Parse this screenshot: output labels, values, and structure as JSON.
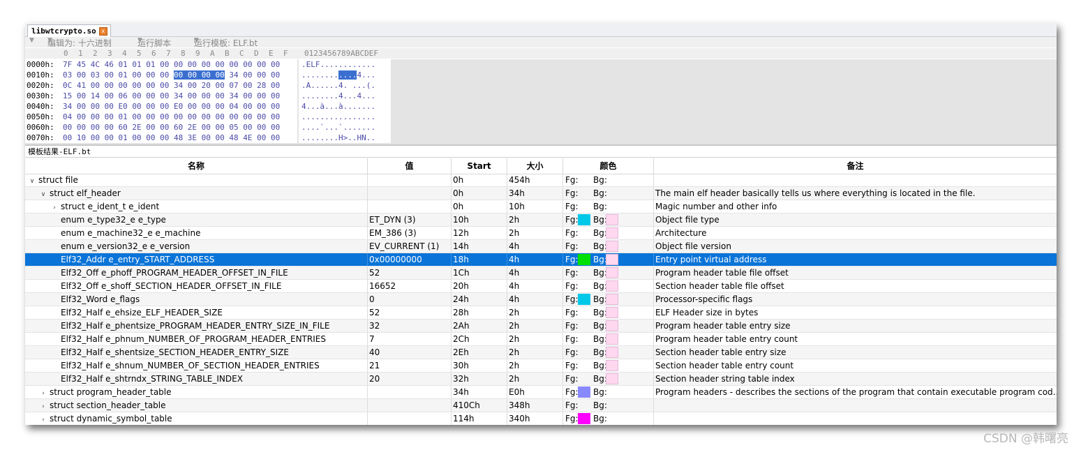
{
  "tab": {
    "label": "libwtcrypto.so",
    "close": "x"
  },
  "toolbar": {
    "edit_as": "编辑为: 十六进制",
    "run_script": "运行脚本",
    "run_template": "运行模板: ELF.bt"
  },
  "hex_header": {
    "columns": [
      "0",
      "1",
      "2",
      "3",
      "4",
      "5",
      "6",
      "7",
      "8",
      "9",
      "A",
      "B",
      "C",
      "D",
      "E",
      "F"
    ],
    "ascii_header": "0123456789ABCDEF"
  },
  "hex_rows": [
    {
      "addr": "0000h:",
      "bytes": "7F 45 4C 46 01 01 01 00 00 00 00 00 00 00 00 00",
      "ascii": ".ELF............"
    },
    {
      "addr": "0010h:",
      "bytes_pre": "03 00 03 00 01 00 00 00 ",
      "bytes_sel": "00 00 00 00",
      "bytes_post": " 34 00 00 00",
      "ascii_pre": "........",
      "ascii_sel": "....",
      "ascii_post": "4..."
    },
    {
      "addr": "0020h:",
      "bytes": "0C 41 00 00 00 00 00 00 34 00 20 00 07 00 28 00",
      "ascii": ".A......4. ...(."
    },
    {
      "addr": "0030h:",
      "bytes": "15 00 14 00 06 00 00 00 34 00 00 00 34 00 00 00",
      "ascii": "........4...4..."
    },
    {
      "addr": "0040h:",
      "bytes": "34 00 00 00 E0 00 00 00 E0 00 00 00 04 00 00 00",
      "ascii": "4...à...à......."
    },
    {
      "addr": "0050h:",
      "bytes": "04 00 00 00 01 00 00 00 00 00 00 00 00 00 00 00",
      "ascii": "................"
    },
    {
      "addr": "0060h:",
      "bytes": "00 00 00 00 60 2E 00 00 60 2E 00 00 05 00 00 00",
      "ascii": "....`...`......."
    },
    {
      "addr": "0070h:",
      "bytes": "00 10 00 00 01 00 00 00 48 3E 00 00 48 4E 00 00",
      "ascii": "........H>..HN.."
    }
  ],
  "results_title": "模板结果-ELF.bt",
  "columns": {
    "name": "名称",
    "value": "值",
    "start": "Start",
    "size": "大小",
    "color": "颜色",
    "comment": "备注"
  },
  "colors": {
    "cyan": "#00c8e8",
    "green": "#00e000",
    "pink": "#ffd8f0",
    "periwinkle": "#8888ff",
    "magenta": "#ff00ff",
    "selection": "#0a74d8"
  },
  "rows": [
    {
      "name": "struct file",
      "value": "",
      "start": "0h",
      "size": "454h",
      "fg": "Fg:",
      "bg": "Bg:",
      "comment": "",
      "expander": "∨",
      "fgcolor": "",
      "bgcolor": ""
    },
    {
      "name": "struct elf_header",
      "value": "",
      "start": "0h",
      "size": "34h",
      "fg": "Fg:",
      "bg": "Bg:",
      "comment": "The main elf header basically tells us where everything is located in the file.",
      "expander": "∨",
      "fgcolor": "",
      "bgcolor": ""
    },
    {
      "name": "struct e_ident_t e_ident",
      "value": "",
      "start": "0h",
      "size": "10h",
      "fg": "Fg:",
      "bg": "Bg:",
      "comment": "Magic number and other info",
      "expander": "›",
      "fgcolor": "",
      "bgcolor": ""
    },
    {
      "name": "enum e_type32_e e_type",
      "value": "ET_DYN (3)",
      "start": "10h",
      "size": "2h",
      "fg": "Fg:",
      "bg": "Bg:",
      "comment": "Object file type",
      "expander": "",
      "fgcolor": "#00c8e8",
      "bgcolor": "#ffd8f0"
    },
    {
      "name": "enum e_machine32_e e_machine",
      "value": "EM_386 (3)",
      "start": "12h",
      "size": "2h",
      "fg": "Fg:",
      "bg": "Bg:",
      "comment": "Architecture",
      "expander": "",
      "fgcolor": "",
      "bgcolor": "#ffd8f0"
    },
    {
      "name": "enum e_version32_e e_version",
      "value": "EV_CURRENT (1)",
      "start": "14h",
      "size": "4h",
      "fg": "Fg:",
      "bg": "Bg:",
      "comment": "Object file version",
      "expander": "",
      "fgcolor": "",
      "bgcolor": "#ffd8f0"
    },
    {
      "name": "Elf32_Addr e_entry_START_ADDRESS",
      "value": "0x00000000",
      "start": "18h",
      "size": "4h",
      "fg": "Fg:",
      "bg": "Bg:",
      "comment": "Entry point virtual address",
      "expander": "",
      "fgcolor": "#00e000",
      "bgcolor": "#ffd8f0"
    },
    {
      "name": "Elf32_Off e_phoff_PROGRAM_HEADER_OFFSET_IN_FILE",
      "value": "52",
      "start": "1Ch",
      "size": "4h",
      "fg": "Fg:",
      "bg": "Bg:",
      "comment": "Program header table file offset",
      "expander": "",
      "fgcolor": "",
      "bgcolor": "#ffd8f0"
    },
    {
      "name": "Elf32_Off e_shoff_SECTION_HEADER_OFFSET_IN_FILE",
      "value": "16652",
      "start": "20h",
      "size": "4h",
      "fg": "Fg:",
      "bg": "Bg:",
      "comment": "Section header table file offset",
      "expander": "",
      "fgcolor": "",
      "bgcolor": "#ffd8f0"
    },
    {
      "name": "Elf32_Word e_flags",
      "value": "0",
      "start": "24h",
      "size": "4h",
      "fg": "Fg:",
      "bg": "Bg:",
      "comment": "Processor-specific flags",
      "expander": "",
      "fgcolor": "#00c8e8",
      "bgcolor": "#ffd8f0"
    },
    {
      "name": "Elf32_Half e_ehsize_ELF_HEADER_SIZE",
      "value": "52",
      "start": "28h",
      "size": "2h",
      "fg": "Fg:",
      "bg": "Bg:",
      "comment": "ELF Header size in bytes",
      "expander": "",
      "fgcolor": "",
      "bgcolor": "#ffd8f0"
    },
    {
      "name": "Elf32_Half e_phentsize_PROGRAM_HEADER_ENTRY_SIZE_IN_FILE",
      "value": "32",
      "start": "2Ah",
      "size": "2h",
      "fg": "Fg:",
      "bg": "Bg:",
      "comment": "Program header table entry size",
      "expander": "",
      "fgcolor": "",
      "bgcolor": "#ffd8f0"
    },
    {
      "name": "Elf32_Half e_phnum_NUMBER_OF_PROGRAM_HEADER_ENTRIES",
      "value": "7",
      "start": "2Ch",
      "size": "2h",
      "fg": "Fg:",
      "bg": "Bg:",
      "comment": "Program header table entry count",
      "expander": "",
      "fgcolor": "",
      "bgcolor": "#ffd8f0"
    },
    {
      "name": "Elf32_Half e_shentsize_SECTION_HEADER_ENTRY_SIZE",
      "value": "40",
      "start": "2Eh",
      "size": "2h",
      "fg": "Fg:",
      "bg": "Bg:",
      "comment": "Section header table entry size",
      "expander": "",
      "fgcolor": "",
      "bgcolor": "#ffd8f0"
    },
    {
      "name": "Elf32_Half e_shnum_NUMBER_OF_SECTION_HEADER_ENTRIES",
      "value": "21",
      "start": "30h",
      "size": "2h",
      "fg": "Fg:",
      "bg": "Bg:",
      "comment": "Section header table entry count",
      "expander": "",
      "fgcolor": "",
      "bgcolor": "#ffd8f0"
    },
    {
      "name": "Elf32_Half e_shtrndx_STRING_TABLE_INDEX",
      "value": "20",
      "start": "32h",
      "size": "2h",
      "fg": "Fg:",
      "bg": "Bg:",
      "comment": "Section header string table index",
      "expander": "",
      "fgcolor": "",
      "bgcolor": "#ffd8f0"
    },
    {
      "name": "struct program_header_table",
      "value": "",
      "start": "34h",
      "size": "E0h",
      "fg": "Fg:",
      "bg": "Bg:",
      "comment": "Program headers - describes the sections of the program that contain executable program cod...",
      "expander": "›",
      "fgcolor": "#8888ff",
      "bgcolor": ""
    },
    {
      "name": "struct section_header_table",
      "value": "",
      "start": "410Ch",
      "size": "348h",
      "fg": "Fg:",
      "bg": "Bg:",
      "comment": "",
      "expander": "›",
      "fgcolor": "",
      "bgcolor": ""
    },
    {
      "name": "struct dynamic_symbol_table",
      "value": "",
      "start": "114h",
      "size": "340h",
      "fg": "Fg:",
      "bg": "Bg:",
      "comment": "",
      "expander": "›",
      "fgcolor": "#ff00ff",
      "bgcolor": ""
    }
  ],
  "watermark": "CSDN @韩曙亮"
}
